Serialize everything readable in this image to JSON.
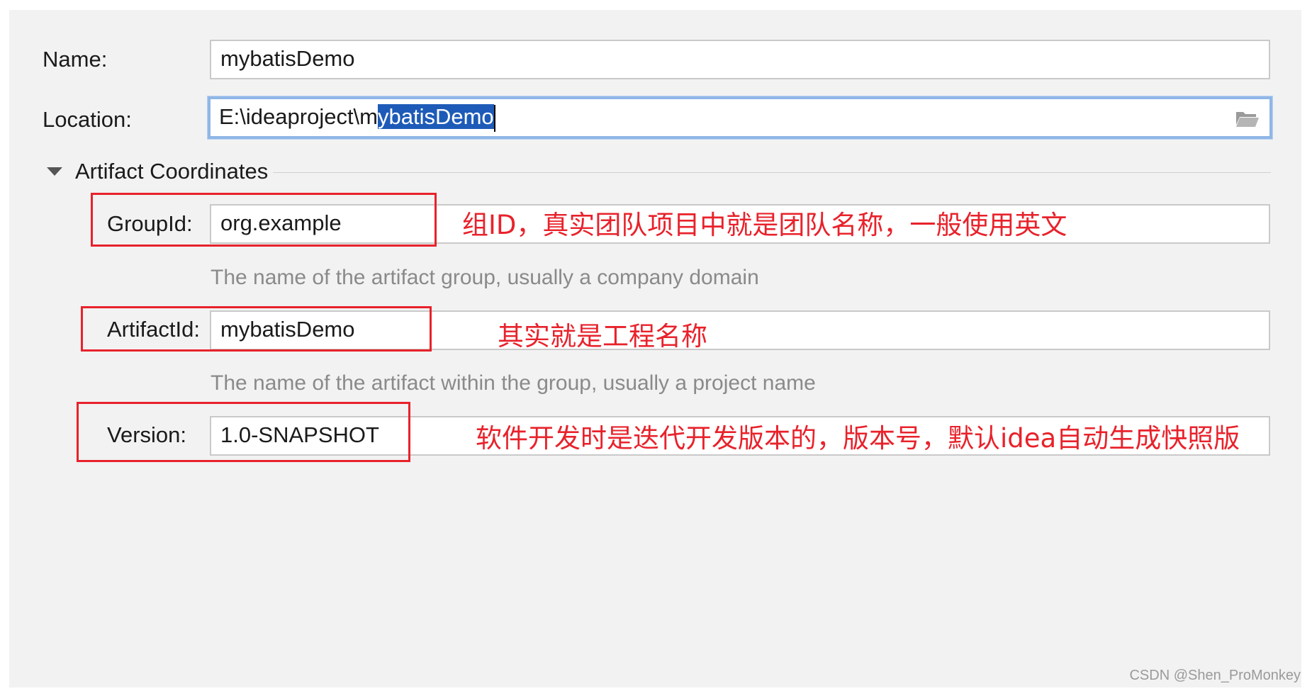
{
  "form": {
    "name_label": "Name:",
    "name_value": "mybatisDemo",
    "location_label": "Location:",
    "location_prefix": "E:\\ideaproject\\m",
    "location_selected": "ybatisDemo",
    "location_suffix": "",
    "section_title": "Artifact Coordinates",
    "groupid_label": "GroupId:",
    "groupid_value": "org.example",
    "groupid_hint": "The name of the artifact group, usually a company domain",
    "artifactid_label": "ArtifactId:",
    "artifactid_value": "mybatisDemo",
    "artifactid_hint": "The name of the artifact within the group, usually a project name",
    "version_label": "Version:",
    "version_value": "1.0-SNAPSHOT"
  },
  "annotations": {
    "groupid_note": "组ID，真实团队项目中就是团队名称，一般使用英文",
    "artifactid_note": "其实就是工程名称",
    "version_note": "软件开发时是迭代开发版本的，版本号，默认idea自动生成快照版"
  },
  "watermark": "CSDN @Shen_ProMonkey",
  "icons": {
    "browse": "folder-open-icon",
    "section_toggle": "triangle-down-icon"
  },
  "colors": {
    "annotation_red": "#e8222b",
    "selection_blue": "#1e5bb8",
    "focus_border": "#8fb6e6",
    "panel_bg": "#f2f2f2"
  }
}
